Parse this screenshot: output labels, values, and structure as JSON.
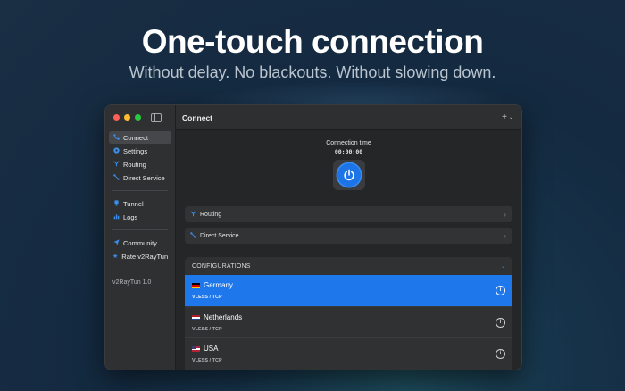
{
  "hero": {
    "headline": "One-touch connection",
    "subline": "Without delay. No blackouts. Without slowing down."
  },
  "sidebar": {
    "groups": [
      [
        {
          "label": "Connect",
          "icon": "connect-icon",
          "active": true
        },
        {
          "label": "Settings",
          "icon": "gear-icon"
        },
        {
          "label": "Routing",
          "icon": "routing-icon"
        },
        {
          "label": "Direct Service",
          "icon": "direct-service-icon"
        }
      ],
      [
        {
          "label": "Tunnel",
          "icon": "tunnel-icon"
        },
        {
          "label": "Logs",
          "icon": "logs-icon"
        }
      ],
      [
        {
          "label": "Community",
          "icon": "paper-plane-icon"
        },
        {
          "label": "Rate v2RayTun",
          "icon": "star-icon"
        }
      ]
    ],
    "version": "v2RayTun 1.0"
  },
  "main": {
    "title": "Connect",
    "add_label": "+",
    "connection_label": "Connection time",
    "connection_time": "00:00:00",
    "rows": [
      {
        "label": "Routing",
        "icon": "routing-icon"
      },
      {
        "label": "Direct Service",
        "icon": "direct-service-icon"
      }
    ],
    "configurations": {
      "header": "CONFIGURATIONS",
      "items": [
        {
          "name": "Germany",
          "protocol": "VLESS / TCP",
          "selected": true
        },
        {
          "name": "Netherlands",
          "protocol": "VLESS / TCP",
          "selected": false
        },
        {
          "name": "USA",
          "protocol": "VLESS / TCP",
          "selected": false
        }
      ]
    }
  },
  "colors": {
    "accent": "#1f77ec",
    "icon_blue": "#3b8fea",
    "traffic_red": "#fe5f57",
    "traffic_yellow": "#febc2e",
    "traffic_green": "#28c840"
  }
}
